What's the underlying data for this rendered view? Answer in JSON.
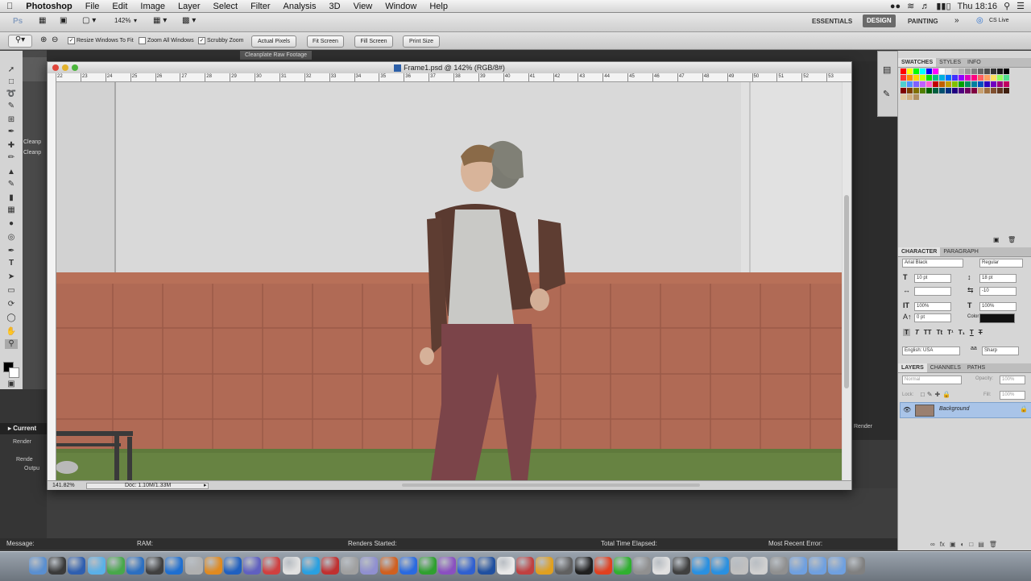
{
  "menubar": {
    "apple": "",
    "app_name": "Photoshop",
    "items": [
      "File",
      "Edit",
      "Image",
      "Layer",
      "Select",
      "Filter",
      "Analysis",
      "3D",
      "View",
      "Window",
      "Help"
    ],
    "clock": "Thu 18:16"
  },
  "appbar": {
    "ps_logo": "Ps",
    "zoom": "142%",
    "workspaces": [
      "ESSENTIALS",
      "DESIGN",
      "PAINTING"
    ],
    "active_workspace": "DESIGN",
    "more": "»",
    "cs_live": "CS Live"
  },
  "options": {
    "resize_windows": "Resize Windows To Fit",
    "zoom_all": "Zoom All Windows",
    "scrubby": "Scrubby Zoom",
    "buttons": [
      "Actual Pixels",
      "Fit Screen",
      "Fill Screen",
      "Print Size"
    ]
  },
  "ae_behind": {
    "tab": "Cleanplate Raw Footage",
    "side_items": [
      "Cleanp",
      "Cleanp"
    ],
    "current": "Current",
    "render": "Render",
    "tree": [
      "Rende",
      "Outpu"
    ],
    "right_render": "Render"
  },
  "document": {
    "title": "Frame1.psd @ 142% (RGB/8#)",
    "zoom_status": "141.82%",
    "doc_status": "Doc: 1.10M/1.33M",
    "ruler_marks": [
      "22",
      "23",
      "24",
      "25",
      "26",
      "27",
      "28",
      "29",
      "30",
      "31",
      "32",
      "33",
      "34",
      "35",
      "36",
      "37",
      "38",
      "39",
      "40",
      "41",
      "42",
      "43",
      "44",
      "45",
      "46",
      "47",
      "48",
      "49",
      "50",
      "51",
      "52",
      "53"
    ]
  },
  "swatches": {
    "tabs": [
      "SWATCHES",
      "STYLES",
      "INFO"
    ],
    "colors": [
      "#ff0000",
      "#ffff00",
      "#00ff00",
      "#00ffff",
      "#0000ff",
      "#ff00ff",
      "#ffffff",
      "#e6e6e6",
      "#cccccc",
      "#b3b3b3",
      "#999999",
      "#808080",
      "#666666",
      "#4d4d4d",
      "#333333",
      "#1a1a1a",
      "#000000",
      "#ff3030",
      "#ff8c00",
      "#ffd400",
      "#c8ff00",
      "#00e000",
      "#00c080",
      "#00b0e0",
      "#0070ff",
      "#4030ff",
      "#9000ff",
      "#e000c0",
      "#ff0080",
      "#ff6060",
      "#ffa060",
      "#ffe060",
      "#90ff60",
      "#50e090",
      "#50d0d0",
      "#5090ff",
      "#8060ff",
      "#c060ff",
      "#ff60d0",
      "#c00000",
      "#c06000",
      "#c0a000",
      "#80c000",
      "#00a000",
      "#009060",
      "#0080a0",
      "#0050c0",
      "#3000c0",
      "#7000c0",
      "#a00080",
      "#c00060",
      "#800000",
      "#804000",
      "#807000",
      "#508000",
      "#006000",
      "#006040",
      "#005070",
      "#003080",
      "#200080",
      "#500080",
      "#700060",
      "#800040",
      "#c8a070",
      "#a07040",
      "#805030",
      "#603820",
      "#402010",
      "#e0c8a0",
      "#d0b080",
      "#b09060"
    ]
  },
  "character": {
    "tabs": [
      "CHARACTER",
      "PARAGRAPH"
    ],
    "font_family": "Arial Black",
    "font_style": "Regular",
    "size": "10 pt",
    "leading": "18 pt",
    "kerning": "",
    "tracking": "-10",
    "vscale": "100%",
    "hscale": "100%",
    "baseline": "0 pt",
    "color_label": "Color:",
    "language": "English: USA",
    "aa": "Sharp"
  },
  "layers": {
    "tabs": [
      "LAYERS",
      "CHANNELS",
      "PATHS"
    ],
    "blend": "Normal",
    "opacity_label": "Opacity:",
    "opacity": "100%",
    "lock_label": "Lock:",
    "fill_label": "Fill:",
    "fill": "100%",
    "items": [
      "Background"
    ]
  },
  "ae_info": {
    "message": "Message:",
    "ram": "RAM:",
    "renders": "Renders Started:",
    "elapsed": "Total Time Elapsed:",
    "error": "Most Recent Error:"
  },
  "dock_colors": [
    "#5a8fd0",
    "#3a3a3a",
    "#2f5fb0",
    "#5ab0e8",
    "#48a84a",
    "#2c6fc0",
    "#404040",
    "#1f6fd0",
    "#b0b0b0",
    "#e08a20",
    "#2060c0",
    "#6060c0",
    "#d04040",
    "#e0e0e0",
    "#2aa0e0",
    "#c03030",
    "#a0a0a0",
    "#9090d0",
    "#d06020",
    "#2a6ae0",
    "#30a030",
    "#8a50c0",
    "#3060d0",
    "#2050a0",
    "#e8e8e8",
    "#c04040",
    "#e0a020",
    "#606060",
    "#202020",
    "#e04020",
    "#30b030",
    "#909090",
    "#e0e0e0",
    "#404040",
    "#2a90e0",
    "#2a90e0",
    "#c0c0c0",
    "#d0d0d0",
    "#909090",
    "#6fa0e0",
    "#6fa0e0",
    "#6fa0e0",
    "#808080"
  ]
}
